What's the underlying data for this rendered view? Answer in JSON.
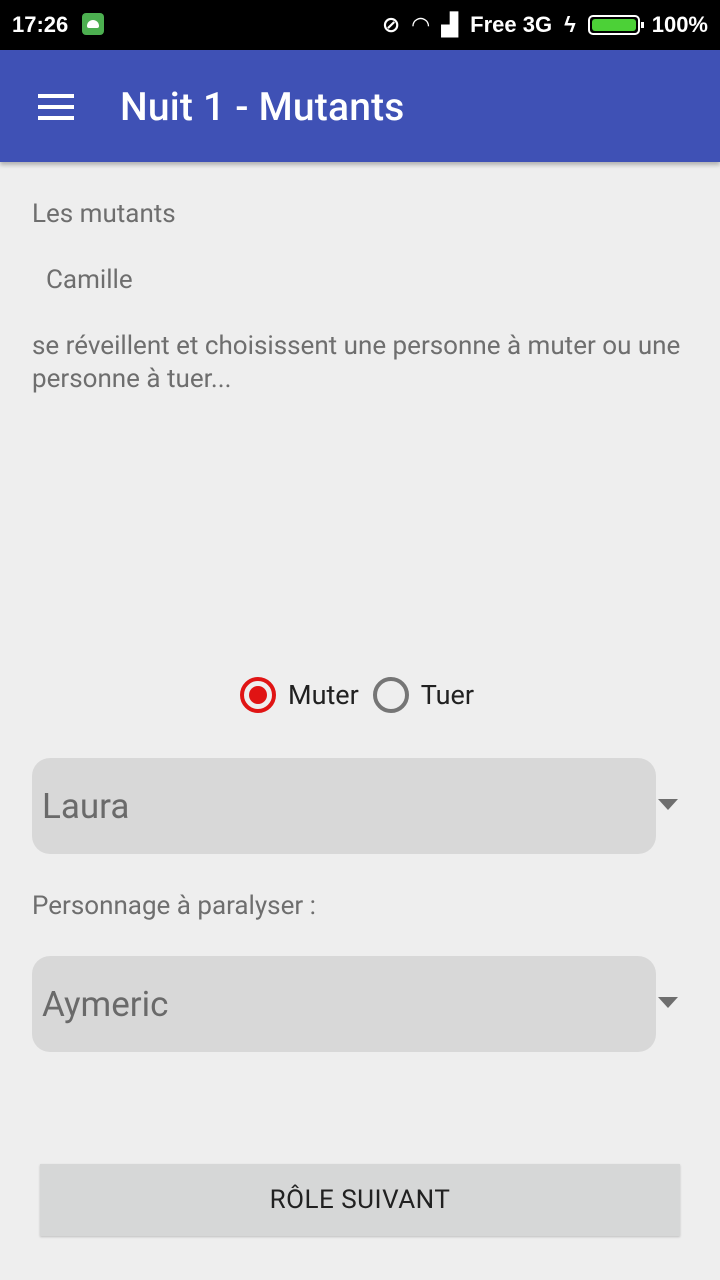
{
  "status_bar": {
    "time": "17:26",
    "carrier": "Free 3G",
    "battery": "100%",
    "icons": [
      "android-notification-icon",
      "vibrate-off-icon",
      "wifi-icon",
      "signal-icon",
      "charging-icon",
      "battery-icon"
    ]
  },
  "app_bar": {
    "title": "Nuit 1 - Mutants",
    "color": "#3f51b5",
    "menu_icon": "hamburger-menu-icon"
  },
  "content": {
    "intro": "Les mutants",
    "player": "Camille",
    "instruction": "se réveillent et choisissent une personne à muter ou une personne à tuer..."
  },
  "action_choice": {
    "options": [
      {
        "label": "Muter",
        "checked": true
      },
      {
        "label": "Tuer",
        "checked": false
      }
    ],
    "accent_color": "#e01414"
  },
  "target_spinner": {
    "selected": "Laura"
  },
  "paralyse": {
    "label": "Personnage à paralyser :",
    "selected": "Aymeric"
  },
  "next_button": {
    "label": "RÔLE SUIVANT"
  }
}
